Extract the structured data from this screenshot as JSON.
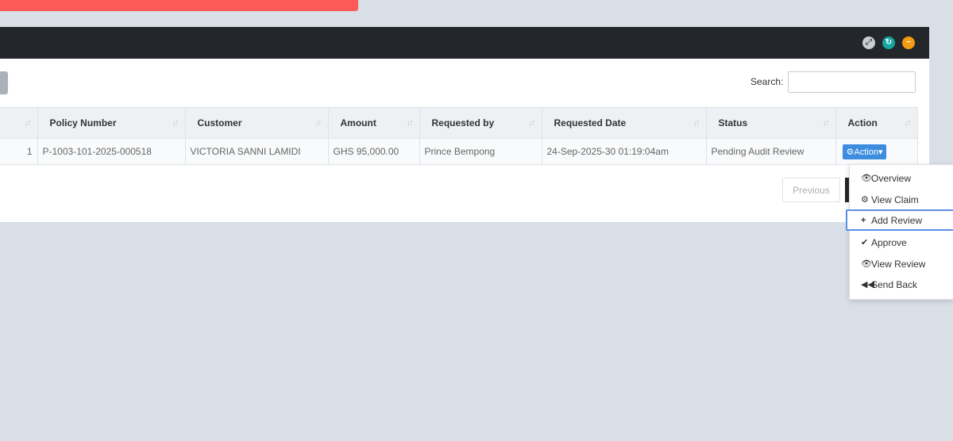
{
  "search": {
    "label": "Search:",
    "value": "",
    "placeholder": ""
  },
  "table": {
    "columns": [
      "",
      "Policy Number",
      "Customer",
      "Amount",
      "Requested by",
      "Requested Date",
      "Status",
      "Action"
    ],
    "rows": [
      {
        "id": "1",
        "policy_number": "P-1003-101-2025-000518",
        "customer": "VICTORIA SANNI LAMIDI",
        "amount": "GHS 95,000.00",
        "requested_by": "Prince Bempong",
        "requested_date": "24-Sep-2025-30 01:19:04am",
        "status": "Pending Audit Review",
        "action_label": "Action"
      }
    ]
  },
  "pagination": {
    "previous": "Previous"
  },
  "dropdown": {
    "items": [
      {
        "icon": "eye-icon",
        "label": "Overview"
      },
      {
        "icon": "cogs-icon",
        "label": "View Claim"
      },
      {
        "icon": "plus-icon",
        "label": "Add Review",
        "active": true
      },
      {
        "icon": "check-icon",
        "label": "Approve"
      },
      {
        "icon": "eye-icon",
        "label": "View Review"
      },
      {
        "icon": "backward-icon",
        "label": "Send Back"
      }
    ]
  },
  "colors": {
    "alert": "#fb5a57",
    "header": "#23272b",
    "accent": "#3c8dde",
    "reload": "#16a7a0",
    "collapse": "#f39c12",
    "focus": "#5b8fe6"
  }
}
